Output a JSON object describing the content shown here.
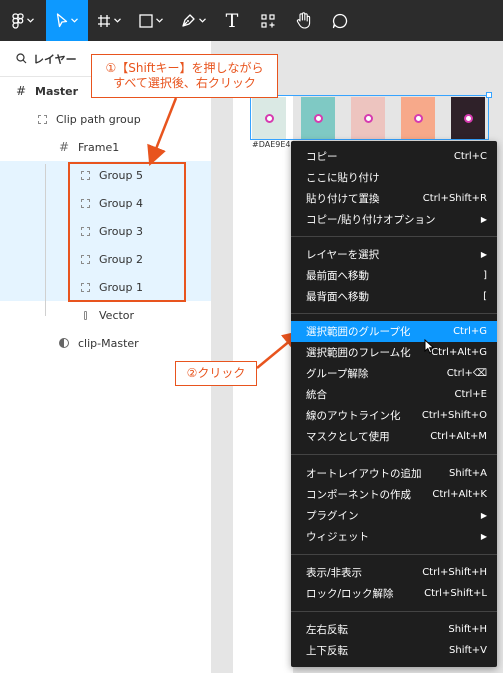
{
  "toolbar": {
    "icons": [
      "figma-menu-icon",
      "move-tool-icon",
      "frame-tool-icon",
      "shape-tool-icon",
      "pen-tool-icon",
      "text-tool-icon",
      "components-icon",
      "hand-tool-icon",
      "comment-icon"
    ],
    "text_tool_glyph": "T"
  },
  "layers_panel": {
    "search_label": "レイヤー",
    "items": [
      {
        "label": "Master",
        "icon": "frame-icon"
      },
      {
        "label": "Clip path group",
        "icon": "group-icon"
      },
      {
        "label": "Frame1",
        "icon": "frame-icon"
      },
      {
        "label": "Group 5",
        "icon": "group-icon",
        "selected": true
      },
      {
        "label": "Group 4",
        "icon": "group-icon",
        "selected": true
      },
      {
        "label": "Group 3",
        "icon": "group-icon",
        "selected": true
      },
      {
        "label": "Group 2",
        "icon": "group-icon",
        "selected": true
      },
      {
        "label": "Group 1",
        "icon": "group-icon",
        "selected": true
      },
      {
        "label": "Vector",
        "icon": "vector-icon"
      },
      {
        "label": "clip-Master",
        "icon": "mask-icon"
      }
    ]
  },
  "canvas": {
    "hex_label": "#DAE9E4",
    "swatches": [
      "#dae9e4",
      "#7fc9c4",
      "#edc4bf",
      "#f7a98a",
      "#2f2129"
    ]
  },
  "callouts": {
    "step1_line1": "①【Shiftキー】を押しながら",
    "step1_line2": "すべて選択後、右クリック",
    "step2": "②クリック"
  },
  "context_menu": {
    "items": [
      {
        "label": "コピー",
        "shortcut": "Ctrl+C"
      },
      {
        "label": "ここに貼り付け",
        "shortcut": ""
      },
      {
        "label": "貼り付けて置換",
        "shortcut": "Ctrl+Shift+R"
      },
      {
        "label": "コピー/貼り付けオプション",
        "shortcut": "▶"
      },
      {
        "label": "レイヤーを選択",
        "shortcut": "▶"
      },
      {
        "label": "最前面へ移動",
        "shortcut": "]"
      },
      {
        "label": "最背面へ移動",
        "shortcut": "["
      },
      {
        "label": "選択範囲のグループ化",
        "shortcut": "Ctrl+G",
        "highlighted": true
      },
      {
        "label": "選択範囲のフレーム化",
        "shortcut": "Ctrl+Alt+G"
      },
      {
        "label": "グループ解除",
        "shortcut": "Ctrl+⌫"
      },
      {
        "label": "統合",
        "shortcut": "Ctrl+E"
      },
      {
        "label": "線のアウトライン化",
        "shortcut": "Ctrl+Shift+O"
      },
      {
        "label": "マスクとして使用",
        "shortcut": "Ctrl+Alt+M"
      },
      {
        "label": "オートレイアウトの追加",
        "shortcut": "Shift+A"
      },
      {
        "label": "コンポーネントの作成",
        "shortcut": "Ctrl+Alt+K"
      },
      {
        "label": "プラグイン",
        "shortcut": "▶"
      },
      {
        "label": "ウィジェット",
        "shortcut": "▶"
      },
      {
        "label": "表示/非表示",
        "shortcut": "Ctrl+Shift+H"
      },
      {
        "label": "ロック/ロック解除",
        "shortcut": "Ctrl+Shift+L"
      },
      {
        "label": "左右反転",
        "shortcut": "Shift+H"
      },
      {
        "label": "上下反転",
        "shortcut": "Shift+V"
      }
    ]
  },
  "colors": {
    "accent": "#0d99ff",
    "annotation": "#e8541e",
    "menu_bg": "#1e1e1e",
    "toolbar_bg": "#2c2c2c",
    "selection_row": "#e5f4ff"
  }
}
